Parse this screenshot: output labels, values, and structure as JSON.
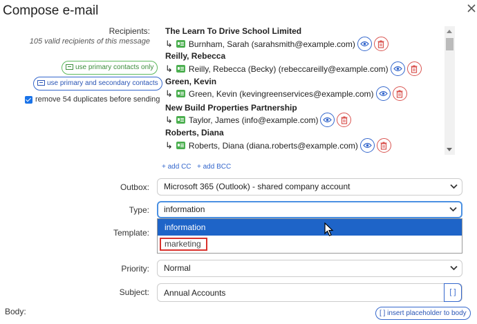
{
  "dialog": {
    "title": "Compose e-mail",
    "close_icon": "close-icon"
  },
  "recipients": {
    "label": "Recipients:",
    "summary": "105 valid recipients of this message",
    "primary_only_label": "use primary contacts only",
    "primary_secondary_label": "use primary and secondary contacts",
    "remove_duplicates_label": "remove 54 duplicates before sending",
    "remove_duplicates_checked": true,
    "list": [
      {
        "org": "The Learn To Drive School Limited",
        "contact": "Burnham, Sarah (sarahsmith@example.com)"
      },
      {
        "org": "Reilly, Rebecca",
        "contact": "Reilly, Rebecca (Becky) (rebeccareilly@example.com)"
      },
      {
        "org": "Green, Kevin",
        "contact": "Green, Kevin (kevingreenservices@example.com)"
      },
      {
        "org": "New Build Properties Partnership",
        "contact": "Taylor, James (info@example.com)"
      },
      {
        "org": "Roberts, Diana",
        "contact": "Roberts, Diana (diana.roberts@example.com)"
      }
    ],
    "add_cc": "+ add CC",
    "add_bcc": "+ add BCC"
  },
  "form": {
    "outbox_label": "Outbox:",
    "outbox_value": "Microsoft 365 (Outlook) - shared company account",
    "type_label": "Type:",
    "type_value": "information",
    "type_options": [
      "information",
      "marketing"
    ],
    "template_label": "Template:",
    "priority_label": "Priority:",
    "priority_value": "Normal",
    "subject_label": "Subject:",
    "subject_value": "Annual Accounts",
    "subject_placeholder_button": "[ ]",
    "body_label": "Body:",
    "insert_placeholder": "[ ] insert placeholder to body"
  },
  "colors": {
    "accent_blue": "#1e64c8",
    "green": "#4caf50",
    "danger_red": "#d9534f"
  }
}
